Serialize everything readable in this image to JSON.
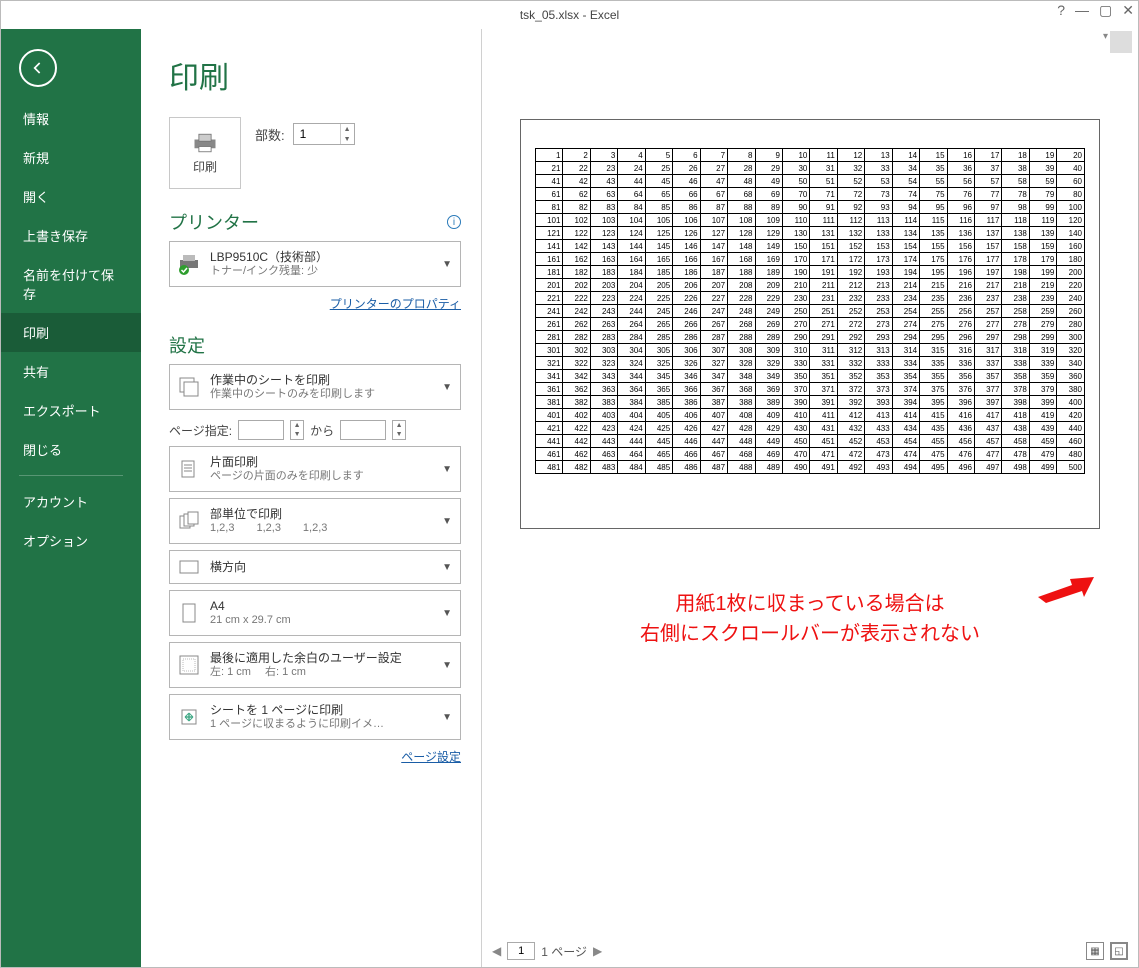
{
  "title": "tsk_05.xlsx - Excel",
  "nav": {
    "items": [
      "情報",
      "新規",
      "開く",
      "上書き保存",
      "名前を付けて保存",
      "印刷",
      "共有",
      "エクスポート",
      "閉じる",
      "アカウント",
      "オプション"
    ],
    "selected": "印刷"
  },
  "page_heading": "印刷",
  "print_button_label": "印刷",
  "copies": {
    "label": "部数:",
    "value": "1"
  },
  "printer": {
    "section_label": "プリンター",
    "name": "LBP9510C（技術部）",
    "status": "トナー/インク残量: 少",
    "properties_link": "プリンターのプロパティ"
  },
  "settings": {
    "section_label": "設定",
    "scope": {
      "title": "作業中のシートを印刷",
      "sub": "作業中のシートのみを印刷します"
    },
    "page_range": {
      "label": "ページ指定:",
      "from": "",
      "to_label": "から",
      "to": ""
    },
    "sides": {
      "title": "片面印刷",
      "sub": "ページの片面のみを印刷します"
    },
    "collate": {
      "title": "部単位で印刷",
      "sub": "1,2,3　　1,2,3　　1,2,3"
    },
    "orientation": {
      "title": "横方向"
    },
    "paper": {
      "title": "A4",
      "sub": "21 cm x 29.7 cm"
    },
    "margins": {
      "title": "最後に適用した余白のユーザー設定",
      "sub": "左:  1 cm　 右:  1 cm"
    },
    "scaling": {
      "title": "シートを 1 ページに印刷",
      "sub": "1 ページに収まるように印刷イメ…"
    },
    "page_setup_link": "ページ設定"
  },
  "preview": {
    "footer": {
      "page_value": "1",
      "page_total_label": "1 ページ"
    },
    "annotation_l1": "用紙1枚に収まっている場合は",
    "annotation_l2": "右側にスクロールバーが表示されない",
    "grid": {
      "cols": 20,
      "rows": 25,
      "start": 1
    }
  }
}
